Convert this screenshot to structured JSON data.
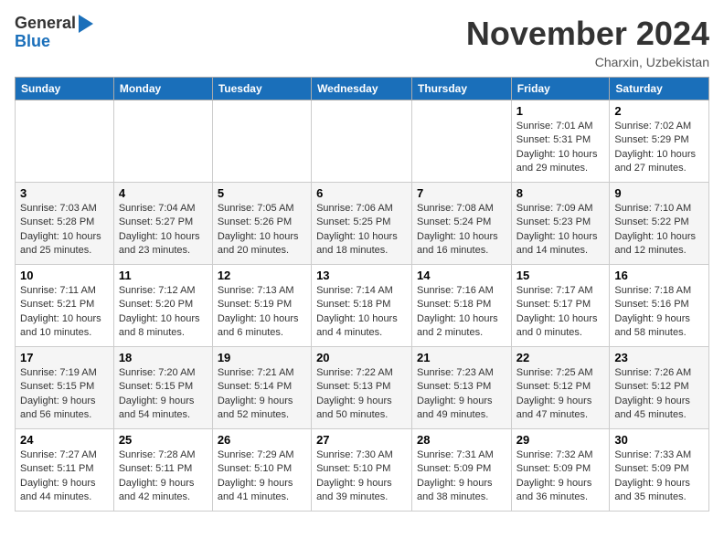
{
  "header": {
    "logo_line1": "General",
    "logo_line2": "Blue",
    "month": "November 2024",
    "location": "Charxin, Uzbekistan"
  },
  "days_of_week": [
    "Sunday",
    "Monday",
    "Tuesday",
    "Wednesday",
    "Thursday",
    "Friday",
    "Saturday"
  ],
  "weeks": [
    [
      {
        "day": "",
        "info": ""
      },
      {
        "day": "",
        "info": ""
      },
      {
        "day": "",
        "info": ""
      },
      {
        "day": "",
        "info": ""
      },
      {
        "day": "",
        "info": ""
      },
      {
        "day": "1",
        "info": "Sunrise: 7:01 AM\nSunset: 5:31 PM\nDaylight: 10 hours and 29 minutes."
      },
      {
        "day": "2",
        "info": "Sunrise: 7:02 AM\nSunset: 5:29 PM\nDaylight: 10 hours and 27 minutes."
      }
    ],
    [
      {
        "day": "3",
        "info": "Sunrise: 7:03 AM\nSunset: 5:28 PM\nDaylight: 10 hours and 25 minutes."
      },
      {
        "day": "4",
        "info": "Sunrise: 7:04 AM\nSunset: 5:27 PM\nDaylight: 10 hours and 23 minutes."
      },
      {
        "day": "5",
        "info": "Sunrise: 7:05 AM\nSunset: 5:26 PM\nDaylight: 10 hours and 20 minutes."
      },
      {
        "day": "6",
        "info": "Sunrise: 7:06 AM\nSunset: 5:25 PM\nDaylight: 10 hours and 18 minutes."
      },
      {
        "day": "7",
        "info": "Sunrise: 7:08 AM\nSunset: 5:24 PM\nDaylight: 10 hours and 16 minutes."
      },
      {
        "day": "8",
        "info": "Sunrise: 7:09 AM\nSunset: 5:23 PM\nDaylight: 10 hours and 14 minutes."
      },
      {
        "day": "9",
        "info": "Sunrise: 7:10 AM\nSunset: 5:22 PM\nDaylight: 10 hours and 12 minutes."
      }
    ],
    [
      {
        "day": "10",
        "info": "Sunrise: 7:11 AM\nSunset: 5:21 PM\nDaylight: 10 hours and 10 minutes."
      },
      {
        "day": "11",
        "info": "Sunrise: 7:12 AM\nSunset: 5:20 PM\nDaylight: 10 hours and 8 minutes."
      },
      {
        "day": "12",
        "info": "Sunrise: 7:13 AM\nSunset: 5:19 PM\nDaylight: 10 hours and 6 minutes."
      },
      {
        "day": "13",
        "info": "Sunrise: 7:14 AM\nSunset: 5:18 PM\nDaylight: 10 hours and 4 minutes."
      },
      {
        "day": "14",
        "info": "Sunrise: 7:16 AM\nSunset: 5:18 PM\nDaylight: 10 hours and 2 minutes."
      },
      {
        "day": "15",
        "info": "Sunrise: 7:17 AM\nSunset: 5:17 PM\nDaylight: 10 hours and 0 minutes."
      },
      {
        "day": "16",
        "info": "Sunrise: 7:18 AM\nSunset: 5:16 PM\nDaylight: 9 hours and 58 minutes."
      }
    ],
    [
      {
        "day": "17",
        "info": "Sunrise: 7:19 AM\nSunset: 5:15 PM\nDaylight: 9 hours and 56 minutes."
      },
      {
        "day": "18",
        "info": "Sunrise: 7:20 AM\nSunset: 5:15 PM\nDaylight: 9 hours and 54 minutes."
      },
      {
        "day": "19",
        "info": "Sunrise: 7:21 AM\nSunset: 5:14 PM\nDaylight: 9 hours and 52 minutes."
      },
      {
        "day": "20",
        "info": "Sunrise: 7:22 AM\nSunset: 5:13 PM\nDaylight: 9 hours and 50 minutes."
      },
      {
        "day": "21",
        "info": "Sunrise: 7:23 AM\nSunset: 5:13 PM\nDaylight: 9 hours and 49 minutes."
      },
      {
        "day": "22",
        "info": "Sunrise: 7:25 AM\nSunset: 5:12 PM\nDaylight: 9 hours and 47 minutes."
      },
      {
        "day": "23",
        "info": "Sunrise: 7:26 AM\nSunset: 5:12 PM\nDaylight: 9 hours and 45 minutes."
      }
    ],
    [
      {
        "day": "24",
        "info": "Sunrise: 7:27 AM\nSunset: 5:11 PM\nDaylight: 9 hours and 44 minutes."
      },
      {
        "day": "25",
        "info": "Sunrise: 7:28 AM\nSunset: 5:11 PM\nDaylight: 9 hours and 42 minutes."
      },
      {
        "day": "26",
        "info": "Sunrise: 7:29 AM\nSunset: 5:10 PM\nDaylight: 9 hours and 41 minutes."
      },
      {
        "day": "27",
        "info": "Sunrise: 7:30 AM\nSunset: 5:10 PM\nDaylight: 9 hours and 39 minutes."
      },
      {
        "day": "28",
        "info": "Sunrise: 7:31 AM\nSunset: 5:09 PM\nDaylight: 9 hours and 38 minutes."
      },
      {
        "day": "29",
        "info": "Sunrise: 7:32 AM\nSunset: 5:09 PM\nDaylight: 9 hours and 36 minutes."
      },
      {
        "day": "30",
        "info": "Sunrise: 7:33 AM\nSunset: 5:09 PM\nDaylight: 9 hours and 35 minutes."
      }
    ]
  ]
}
